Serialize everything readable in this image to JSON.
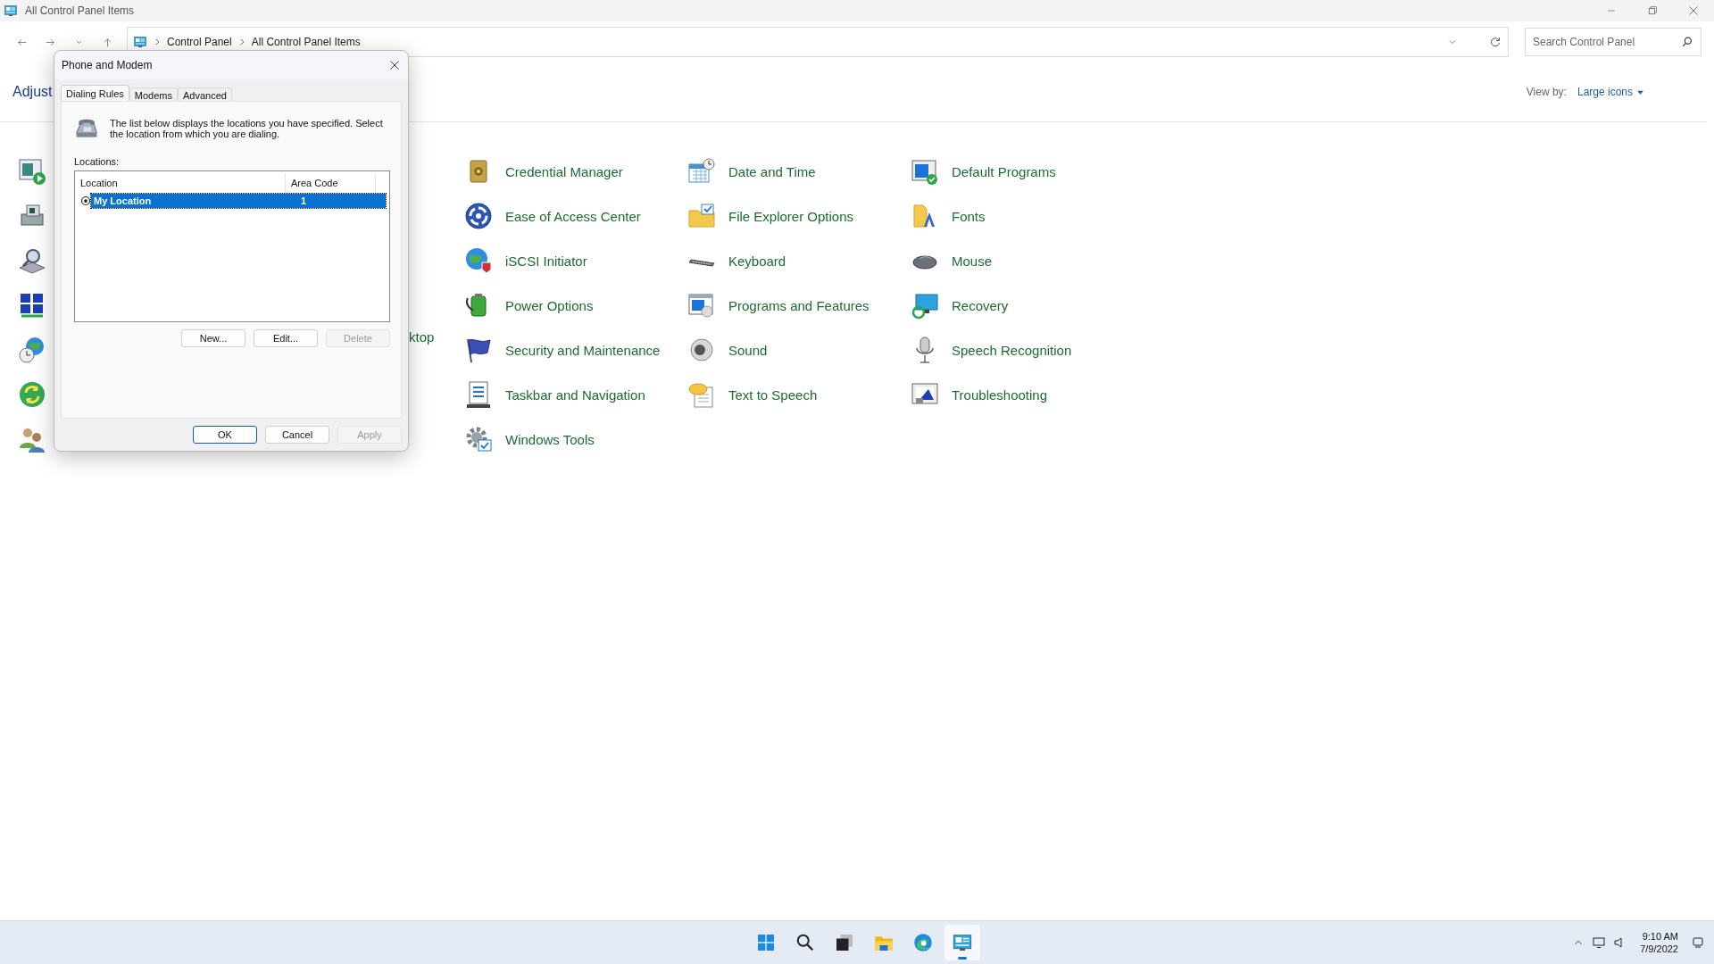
{
  "window": {
    "title": "All Control Panel Items"
  },
  "address": {
    "path": [
      "Control Panel",
      "All Control Panel Items"
    ]
  },
  "search": {
    "placeholder": "Search Control Panel"
  },
  "header": {
    "title": "Adjust",
    "view_by_label": "View by:",
    "view_by_value": "Large icons"
  },
  "left_icons": [
    {
      "kind": "media"
    },
    {
      "kind": "printer"
    },
    {
      "kind": "magnifier"
    },
    {
      "kind": "network"
    },
    {
      "kind": "globe-clock"
    },
    {
      "kind": "sync"
    },
    {
      "kind": "users"
    }
  ],
  "partial_label": "ktop",
  "items": [
    {
      "label": "Credential Manager",
      "kind": "vault"
    },
    {
      "label": "Date and Time",
      "kind": "calendar"
    },
    {
      "label": "Default Programs",
      "kind": "default"
    },
    {
      "label": "Ease of Access Center",
      "kind": "ease"
    },
    {
      "label": "File Explorer Options",
      "kind": "folder"
    },
    {
      "label": "Fonts",
      "kind": "fonts"
    },
    {
      "label": "iSCSI Initiator",
      "kind": "globe"
    },
    {
      "label": "Keyboard",
      "kind": "keyboard"
    },
    {
      "label": "Mouse",
      "kind": "mouse"
    },
    {
      "label": "Power Options",
      "kind": "battery"
    },
    {
      "label": "Programs and Features",
      "kind": "programs"
    },
    {
      "label": "Recovery",
      "kind": "recovery"
    },
    {
      "label": "Security and Maintenance",
      "kind": "flag"
    },
    {
      "label": "Sound",
      "kind": "speaker"
    },
    {
      "label": "Speech Recognition",
      "kind": "microphone"
    },
    {
      "label": "Taskbar and Navigation",
      "kind": "list"
    },
    {
      "label": "Text to Speech",
      "kind": "bubble"
    },
    {
      "label": "Troubleshooting",
      "kind": "troubleshoot"
    },
    {
      "label": "Windows Tools",
      "kind": "gear"
    }
  ],
  "dialog": {
    "title": "Phone and Modem",
    "tabs": [
      {
        "label": "Dialing Rules",
        "selected": true
      },
      {
        "label": "Modems",
        "selected": false
      },
      {
        "label": "Advanced",
        "selected": false
      }
    ],
    "description": "The list below displays the locations you have specified. Select the location from which you are dialing.",
    "locations_label": "Locations:",
    "columns": [
      "Location",
      "Area Code"
    ],
    "rows": [
      {
        "location": "My Location",
        "area_code": "1",
        "selected": true
      }
    ],
    "buttons": [
      {
        "label": "New...",
        "disabled": false
      },
      {
        "label": "Edit...",
        "disabled": false
      },
      {
        "label": "Delete",
        "disabled": true
      }
    ],
    "footer_buttons": [
      {
        "label": "OK",
        "default": true,
        "disabled": false
      },
      {
        "label": "Cancel",
        "default": false,
        "disabled": false
      },
      {
        "label": "Apply",
        "default": false,
        "disabled": true
      }
    ]
  },
  "taskbar": {
    "apps": [
      {
        "kind": "start",
        "active": false
      },
      {
        "kind": "search",
        "active": false
      },
      {
        "kind": "taskview",
        "active": false
      },
      {
        "kind": "explorer",
        "active": false
      },
      {
        "kind": "edge",
        "active": false
      },
      {
        "kind": "control-panel",
        "active": true
      }
    ],
    "time": "9:10 AM",
    "date": "7/9/2022"
  }
}
